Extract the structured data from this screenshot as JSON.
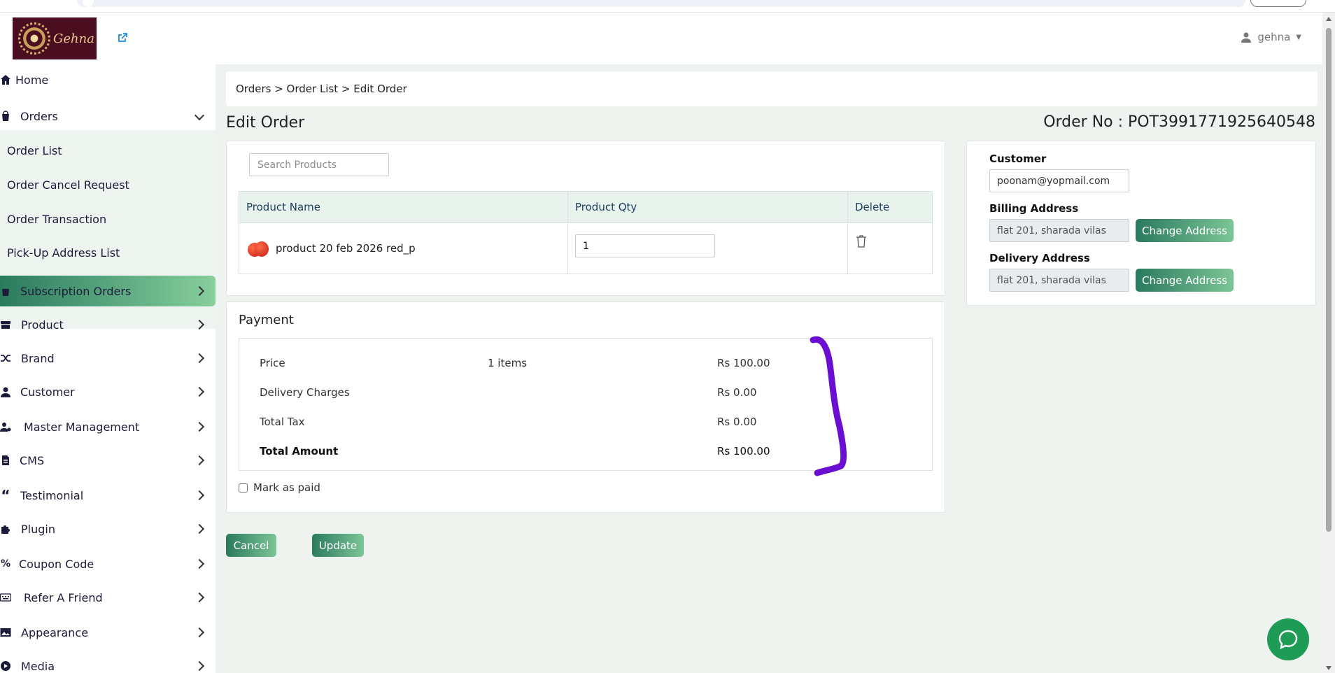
{
  "header": {
    "logo_text": "Gehna",
    "user_name": "gehna"
  },
  "sidebar": {
    "home": "Home",
    "orders": "Orders",
    "orders_sub": [
      "Order List",
      "Order Cancel Request",
      "Order Transaction",
      "Pick-Up Address List"
    ],
    "items": [
      "Subscription Orders",
      "Product",
      "Brand",
      "Customer",
      "Master Management",
      "CMS",
      "Testimonial",
      "Plugin",
      "Coupon Code",
      "Refer A Friend",
      "Appearance",
      "Media"
    ],
    "active_item": "Subscription Orders"
  },
  "breadcrumb": {
    "text": "Orders > Order List > Edit Order"
  },
  "page": {
    "title": "Edit Order",
    "order_no": "Order No : POT3991771925640548"
  },
  "products": {
    "search_placeholder": "Search Products",
    "columns": [
      "Product Name",
      "Product Qty",
      "Delete"
    ],
    "rows": [
      {
        "name": "product 20 feb 2026 red_p",
        "qty": "1"
      }
    ]
  },
  "payment": {
    "title": "Payment",
    "rows": [
      {
        "label": "Price",
        "items": "1 items",
        "amount": "Rs 100.00"
      },
      {
        "label": "Delivery Charges",
        "items": "",
        "amount": "Rs 0.00"
      },
      {
        "label": "Total Tax",
        "items": "",
        "amount": "Rs 0.00"
      },
      {
        "label": "Total Amount",
        "items": "",
        "amount": "Rs 100.00"
      }
    ],
    "mark_paid_label": "Mark as paid",
    "mark_paid_checked": false
  },
  "actions": {
    "cancel": "Cancel",
    "update": "Update"
  },
  "customer_panel": {
    "customer_label": "Customer",
    "customer_value": "poonam@yopmail.com",
    "billing_label": "Billing Address",
    "billing_value": "flat 201, sharada vilas",
    "delivery_label": "Delivery Address",
    "delivery_value": "flat 201, sharada vilas",
    "change_address": "Change Address"
  },
  "colors": {
    "brand_green": "#2a7a5e",
    "brand_green_light": "#87cf9c",
    "sidebar_sub_bg": "#eef5f1",
    "annotation_purple": "#6a0fd1",
    "chat_green": "#1e9c56"
  }
}
